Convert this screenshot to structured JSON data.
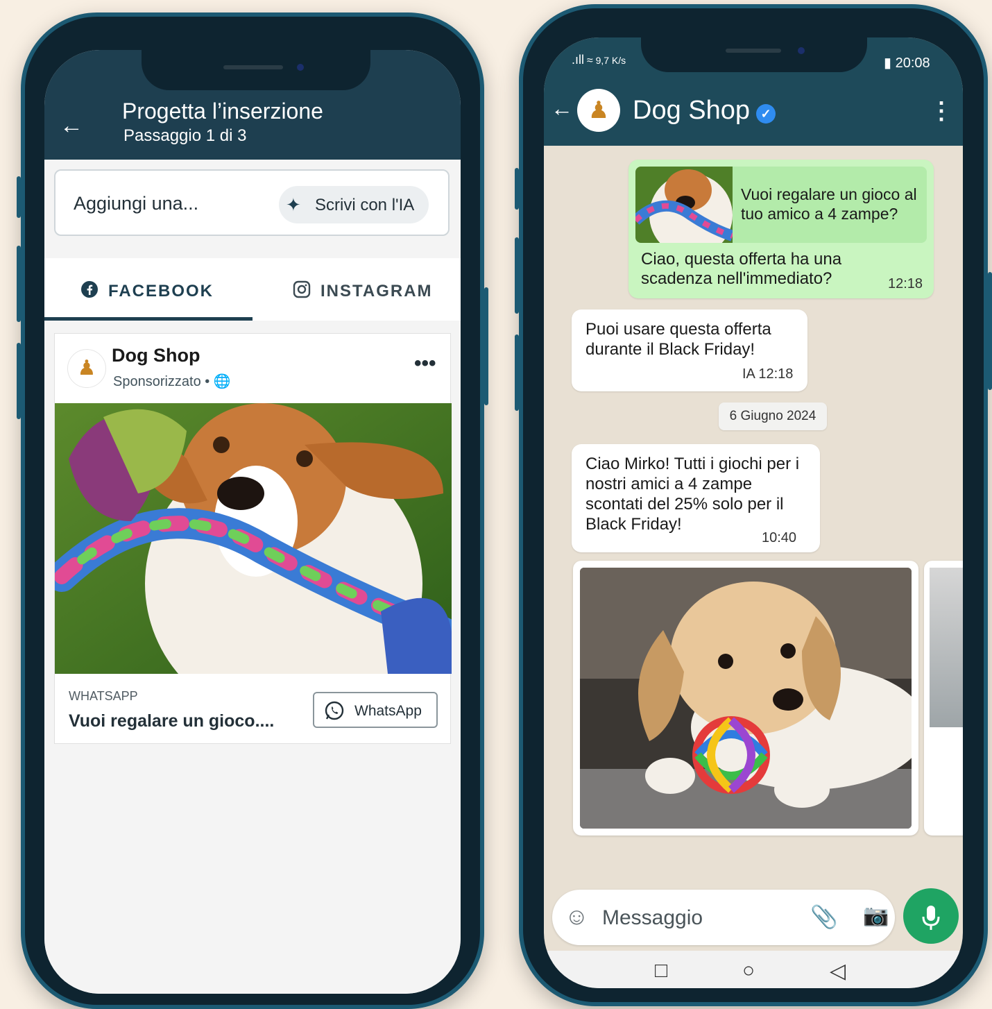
{
  "left_phone": {
    "header": {
      "back_icon": "arrow-left-icon",
      "title": "Progetta l’inserzione",
      "subtitle": "Passaggio 1 di 3"
    },
    "add_box": {
      "label": "Aggiungi una...",
      "ai_button_label": "Scrivi con l'IA",
      "ai_icon": "sparkle-icon"
    },
    "tabs": [
      {
        "label": "FACEBOOK",
        "icon": "facebook-icon",
        "active": true
      },
      {
        "label": "INSTAGRAM",
        "icon": "instagram-icon",
        "active": false
      }
    ],
    "post": {
      "page_name": "Dog Shop",
      "sponsored": "Sponsorizzato • ",
      "globe_icon": "globe-icon",
      "more_icon": "more-horizontal-icon",
      "cta_sub": "WHATSAPP",
      "cta_title": "Vuoi regalare un gioco....",
      "cta_button": "WhatsApp"
    }
  },
  "right_phone": {
    "status": {
      "signal": ".ıll",
      "speed": "9,7 K/s",
      "battery_icon": "battery-icon",
      "time": "20:08"
    },
    "header": {
      "contact_name": "Dog Shop",
      "verified": "✓"
    },
    "messages": [
      {
        "direction": "out",
        "quote": "Vuoi regalare un gioco al tuo amico a 4 zampe?",
        "text": "Ciao, questa offerta ha una scadenza nell'immediato?",
        "time": "12:18"
      },
      {
        "direction": "in",
        "text": "Puoi usare questa offerta durante il Black Friday!",
        "time": "IA  12:18"
      },
      {
        "direction": "in",
        "text": "Ciao Mirko! Tutti i giochi per i nostri amici a 4 zampe scontati del 25% solo per il Black Friday!",
        "time": "10:40"
      }
    ],
    "date_chip": "6 Giugno 2024",
    "input": {
      "placeholder": "Messaggio"
    }
  },
  "colors": {
    "background": "#f8efe3",
    "phone_frame": "#1c5a73",
    "header_dark": "#1e3f50",
    "whatsapp_green": "#1fa463",
    "outgoing_bubble": "#c9f5c0"
  }
}
